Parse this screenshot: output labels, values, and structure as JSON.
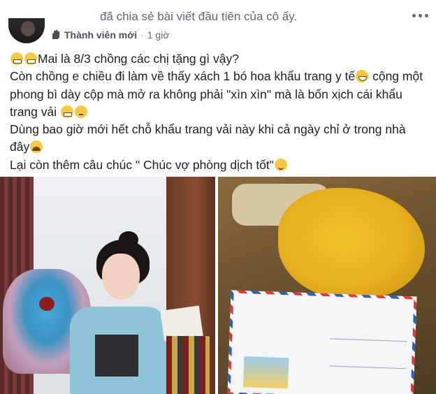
{
  "header": {
    "shared_text": "đã chia sẻ bài viết đầu tiên của cô ấy.",
    "member_badge": "Thành viên mới",
    "separator": "·",
    "time": "1 giờ"
  },
  "post": {
    "lines": [
      "Mai là 8/3 chồng các chị tặng gì vậy?",
      "Còn chồng e chiều đi làm về thấy xách 1 bó hoa khẩu trang y tế",
      " cộng một",
      "phong bì dày cộp mà mở ra không phải \"xìn xìn\" mà là bốn xịch cái khẩu",
      "trang vải ",
      "Dùng bao giờ mới hết chỗ khẩu trang vải này khi cả ngày chỉ ở trong nhà",
      "đây",
      "Lại còn thêm câu chúc \" Chúc vợ phòng dịch tốt\""
    ]
  },
  "icons": {
    "more": "more-horizontal-icon",
    "member": "member-wave-icon"
  },
  "photos": [
    {
      "name": "photo-woman-bouquet"
    },
    {
      "name": "photo-masks-envelope"
    }
  ]
}
